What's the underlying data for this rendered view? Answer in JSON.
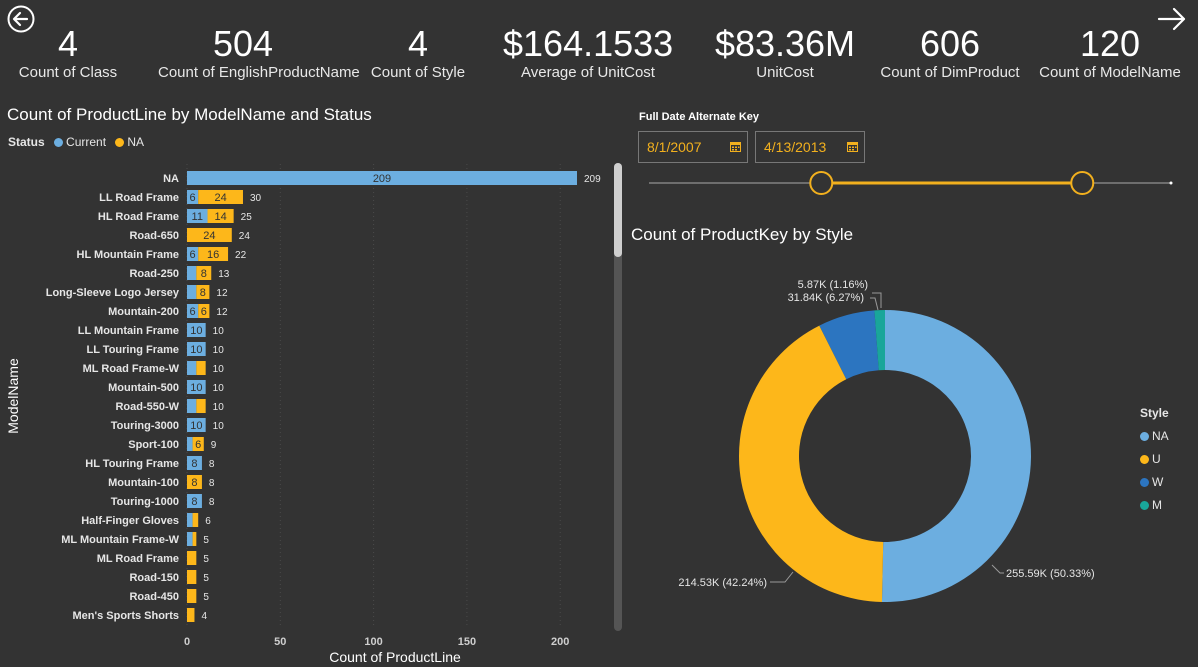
{
  "kpis": [
    {
      "value": "4",
      "label": "Count of Class"
    },
    {
      "value": "504",
      "label": "Count of EnglishProductName"
    },
    {
      "value": "4",
      "label": "Count of Style"
    },
    {
      "value": "$164.1533",
      "label": "Average of UnitCost"
    },
    {
      "value": "$83.36M",
      "label": "UnitCost"
    },
    {
      "value": "606",
      "label": "Count of DimProduct"
    },
    {
      "value": "120",
      "label": "Count of ModelName"
    }
  ],
  "colors": {
    "current": "#6caee0",
    "na": "#fdb71a",
    "w": "#2c75c0",
    "m": "#19a69a",
    "background": "#333333"
  },
  "bar_title": "Count of ProductLine by ModelName and Status",
  "bar_legend": {
    "title": "Status",
    "items": [
      "Current",
      "NA"
    ]
  },
  "slicer": {
    "title": "Full Date Alternate Key",
    "start": "8/1/2007",
    "end": "4/13/2013",
    "start_fraction": 0.33,
    "end_fraction": 0.83
  },
  "donut_title": "Count of ProductKey by Style",
  "style_legend": {
    "title": "Style",
    "items": [
      "NA",
      "U",
      "W",
      "M"
    ]
  },
  "chart_data": [
    {
      "type": "bar",
      "orientation": "horizontal",
      "stacked": true,
      "title": "Count of ProductLine by ModelName and Status",
      "xlabel": "Count of ProductLine",
      "ylabel": "ModelName",
      "xlim": [
        0,
        215
      ],
      "xticks": [
        0,
        50,
        100,
        150,
        200
      ],
      "legend": "top-left",
      "categories": [
        "NA",
        "LL Road Frame",
        "HL Road Frame",
        "Road-650",
        "HL Mountain Frame",
        "Road-250",
        "Long-Sleeve Logo Jersey",
        "Mountain-200",
        "LL Mountain Frame",
        "LL Touring Frame",
        "ML Road Frame-W",
        "Mountain-500",
        "Road-550-W",
        "Touring-3000",
        "Sport-100",
        "HL Touring Frame",
        "Mountain-100",
        "Touring-1000",
        "Half-Finger Gloves",
        "ML Mountain Frame-W",
        "ML Road Frame",
        "Road-150",
        "Road-450",
        "Men's Sports Shorts"
      ],
      "series": [
        {
          "name": "Current",
          "values": [
            209,
            6,
            11,
            0,
            6,
            5,
            5,
            6,
            10,
            10,
            5,
            10,
            5,
            10,
            3,
            8,
            0,
            8,
            3,
            3,
            0,
            0,
            0,
            0
          ]
        },
        {
          "name": "NA",
          "values": [
            0,
            24,
            14,
            24,
            16,
            8,
            7,
            6,
            0,
            0,
            5,
            0,
            5,
            0,
            6,
            0,
            8,
            0,
            3,
            2,
            5,
            5,
            5,
            4
          ]
        }
      ],
      "totals": [
        209,
        30,
        25,
        24,
        22,
        13,
        12,
        12,
        10,
        10,
        10,
        10,
        10,
        10,
        9,
        8,
        8,
        8,
        6,
        5,
        5,
        5,
        5,
        4
      ],
      "segment_labels": {
        "Current": [
          "209",
          "6",
          "11",
          "",
          "6",
          "",
          "",
          "6",
          "10",
          "10",
          "",
          "10",
          "",
          "10",
          "",
          "8",
          "",
          "8",
          "",
          "",
          "",
          "",
          "",
          ""
        ],
        "NA": [
          "",
          "24",
          "14",
          "24",
          "16",
          "8",
          "8",
          "6",
          "",
          "",
          "",
          "",
          "",
          "",
          "6",
          "",
          "8",
          "",
          "",
          "",
          "",
          "",
          "",
          ""
        ]
      }
    },
    {
      "type": "pie",
      "donut": true,
      "title": "Count of ProductKey by Style",
      "legend": "right",
      "categories": [
        "NA",
        "U",
        "W",
        "M"
      ],
      "values": [
        255590,
        214530,
        31840,
        5870
      ],
      "data_labels": [
        "255.59K (50.33%)",
        "214.53K (42.24%)",
        "31.84K (6.27%)",
        "5.87K (1.16%)"
      ]
    }
  ]
}
